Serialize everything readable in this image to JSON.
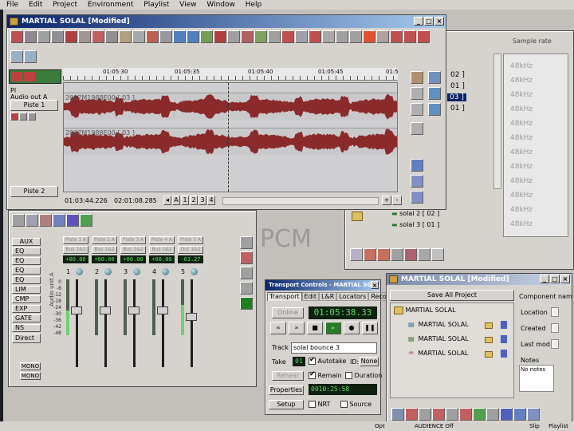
{
  "os_menu": [
    "File",
    "Edit",
    "Project",
    "Environment",
    "Playlist",
    "View",
    "Window",
    "Help"
  ],
  "main_window": {
    "title": "MARTIAL SOLAL [Modified]",
    "ruler": [
      "01:05:30",
      "01:05:35",
      "01:05:40",
      "01:05:45",
      "01:5"
    ],
    "label_pl": "Pl",
    "audio_out": "Audio out A",
    "tracks": [
      {
        "name": "Piste 1",
        "clip": "2007M1988E00 [ 03 ]"
      },
      {
        "name": "Piste 2",
        "clip": "2007M1988E00 [ 03 ]"
      }
    ],
    "time_start": "01:03:44.226",
    "time_end": "02:01:08.285",
    "nav_buttons": [
      "A",
      "1",
      "2",
      "3",
      "4"
    ]
  },
  "right_panel": {
    "header": "Sample rate",
    "rates": [
      "48kHz",
      "48kHz",
      "48kHz",
      "48kHz",
      "48kHz",
      "48kHz",
      "48kHz",
      "48kHz",
      "48kHz",
      "48kHz",
      "48kHz",
      "48kHz"
    ],
    "indices": [
      "02 ]",
      "01 ]",
      "03 ]",
      "01 ]"
    ],
    "list": [
      "solal 2 [ 02 ]",
      "solal 3 [ 01 ]"
    ]
  },
  "mixer": {
    "left_buttons": [
      "AUX",
      "EQ",
      "EQ",
      "EQ",
      "EQ",
      "LIM",
      "CMP",
      "EXP",
      "GATE",
      "NS",
      "Direct"
    ],
    "mono": [
      "MONO",
      "MONO"
    ],
    "inputs": [
      "Piste 1 A",
      "Piste 2 A",
      "Piste 3 A",
      "Piste 4 A",
      "Piste 5 A"
    ],
    "buses": [
      "Bus 1&2",
      "Bus 1&2",
      "Bus 1&2",
      "Bus 1&2",
      "Out 1&2"
    ],
    "gains": [
      "+00.00",
      "+00.00",
      "+00.00",
      "+00.00",
      "-03.27"
    ],
    "channels": [
      "1",
      "2",
      "3",
      "4",
      "5"
    ],
    "scale": [
      "0",
      "-6",
      "-12",
      "-18",
      "-24",
      "-30",
      "-36",
      "-42",
      "-48"
    ],
    "side_label": "Audio unit A"
  },
  "watermark": "PCM",
  "transport": {
    "title": "Transport Controls - MARTIAL SOLAL",
    "tabs": [
      "Transport",
      "Edit",
      "L&R",
      "Locators",
      "Record"
    ],
    "online_label": "Online",
    "timecode": "01:05:38.33",
    "track_label": "Track",
    "track_value": "solal bounce 3",
    "take_label": "Take",
    "take_value": "01",
    "autotake_label": "Autotake",
    "id_label": "ID:",
    "id_value": "None",
    "rehear_label": "Rehear",
    "remain_label": "Remain",
    "duration_label": "Duration",
    "remain_value": "0010:25:58",
    "properties_label": "Properties",
    "setup_label": "Setup",
    "nrt_label": "NRT",
    "source_label": "Source"
  },
  "project_window": {
    "title": "MARTIAL SOLAL [Modified]",
    "save_all": "Save All Project",
    "root": "MARTIAL SOLAL",
    "items": [
      "MARTIAL SOLAL",
      "MARTIAL SOLAL",
      "MARTIAL SOLAL"
    ],
    "component_label": "Component nam",
    "fields": [
      "Location",
      "Created",
      "Last mod."
    ],
    "notes_label": "Notes",
    "notes_value": "No notes"
  },
  "status_bar": {
    "left": "Opt",
    "mid": "AUDIENCE   Off",
    "right1": "Slip",
    "right2": "Playlist"
  },
  "colors": {
    "waveform": "#8a2a2a",
    "lcd": "#58e060",
    "title_active": "#0a246a"
  }
}
